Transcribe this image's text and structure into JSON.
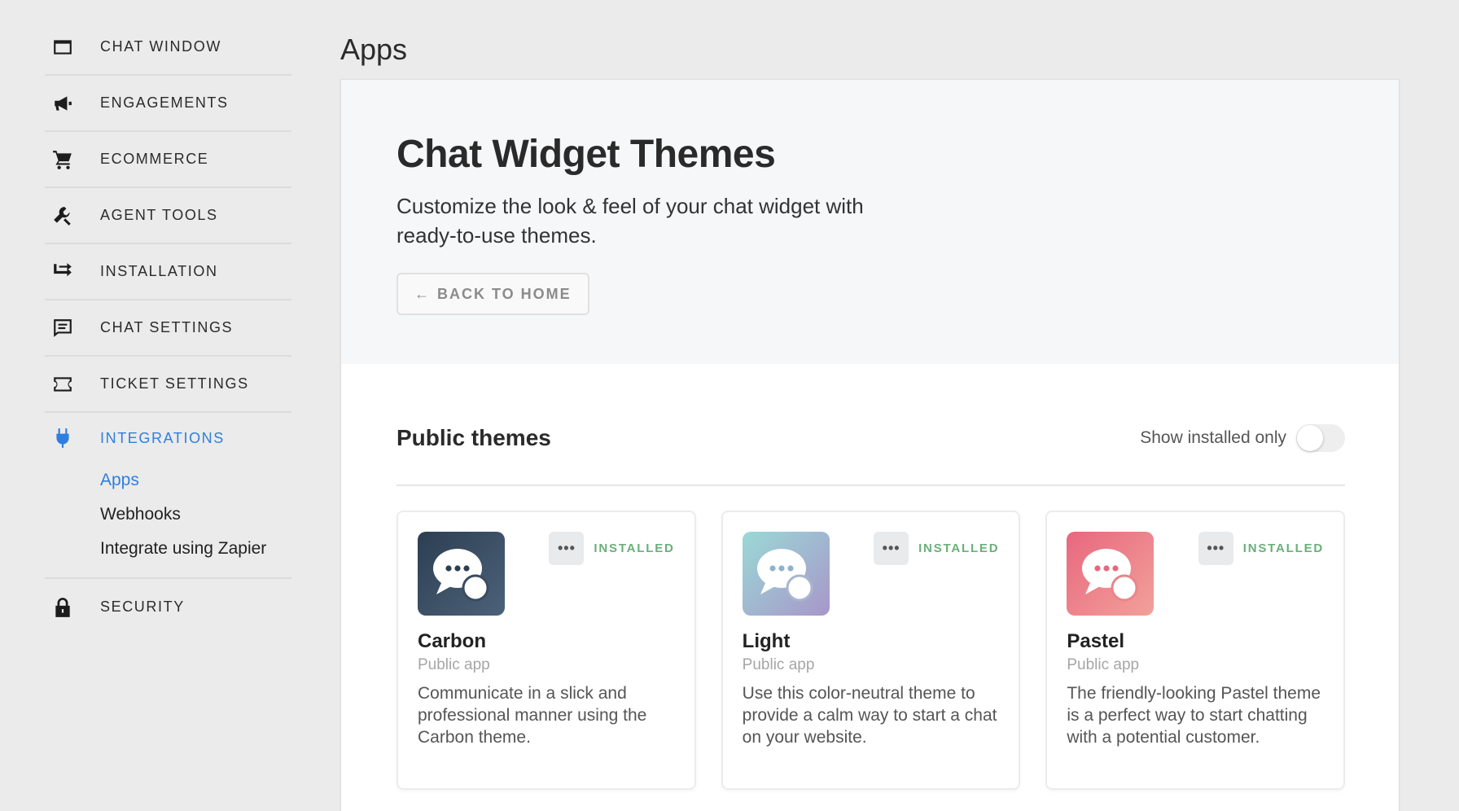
{
  "sidebar": {
    "items": [
      {
        "label": "CHAT WINDOW",
        "icon": "window-icon"
      },
      {
        "label": "ENGAGEMENTS",
        "icon": "megaphone-icon"
      },
      {
        "label": "ECOMMERCE",
        "icon": "cart-icon"
      },
      {
        "label": "AGENT TOOLS",
        "icon": "wrench-icon"
      },
      {
        "label": "INSTALLATION",
        "icon": "installation-icon"
      },
      {
        "label": "CHAT SETTINGS",
        "icon": "chat-settings-icon"
      },
      {
        "label": "TICKET SETTINGS",
        "icon": "ticket-icon"
      },
      {
        "label": "INTEGRATIONS",
        "icon": "plug-icon",
        "active": true
      },
      {
        "label": "SECURITY",
        "icon": "lock-icon"
      }
    ],
    "subitems": [
      {
        "label": "Apps",
        "active": true
      },
      {
        "label": "Webhooks"
      },
      {
        "label": "Integrate using Zapier"
      }
    ]
  },
  "page": {
    "title": "Apps"
  },
  "hero": {
    "title": "Chat Widget Themes",
    "description": "Customize the look & feel of your chat widget with ready-to-use themes.",
    "back_label": "BACK TO HOME"
  },
  "section": {
    "title": "Public themes",
    "toggle_label": "Show installed only"
  },
  "cards": [
    {
      "name": "Carbon",
      "type": "Public app",
      "status": "INSTALLED",
      "more": "•••",
      "description": "Communicate in a slick and professional manner using the Carbon theme.",
      "icon": "carbon-theme-icon"
    },
    {
      "name": "Light",
      "type": "Public app",
      "status": "INSTALLED",
      "more": "•••",
      "description": "Use this color-neutral theme to provide a calm way to start a chat on your website.",
      "icon": "light-theme-icon"
    },
    {
      "name": "Pastel",
      "type": "Public app",
      "status": "INSTALLED",
      "more": "•••",
      "description": "The friendly-looking Pastel theme is a perfect way to start chatting with a potential customer.",
      "icon": "pastel-theme-icon"
    }
  ],
  "colors": {
    "accent": "#2f7fe0",
    "installed": "#6ab07a",
    "carbon_start": "#2d3e52",
    "carbon_end": "#4c627a",
    "light_start": "#9ad9d6",
    "light_end": "#a896c9",
    "pastel_start": "#e8677e",
    "pastel_end": "#f2a19a"
  }
}
